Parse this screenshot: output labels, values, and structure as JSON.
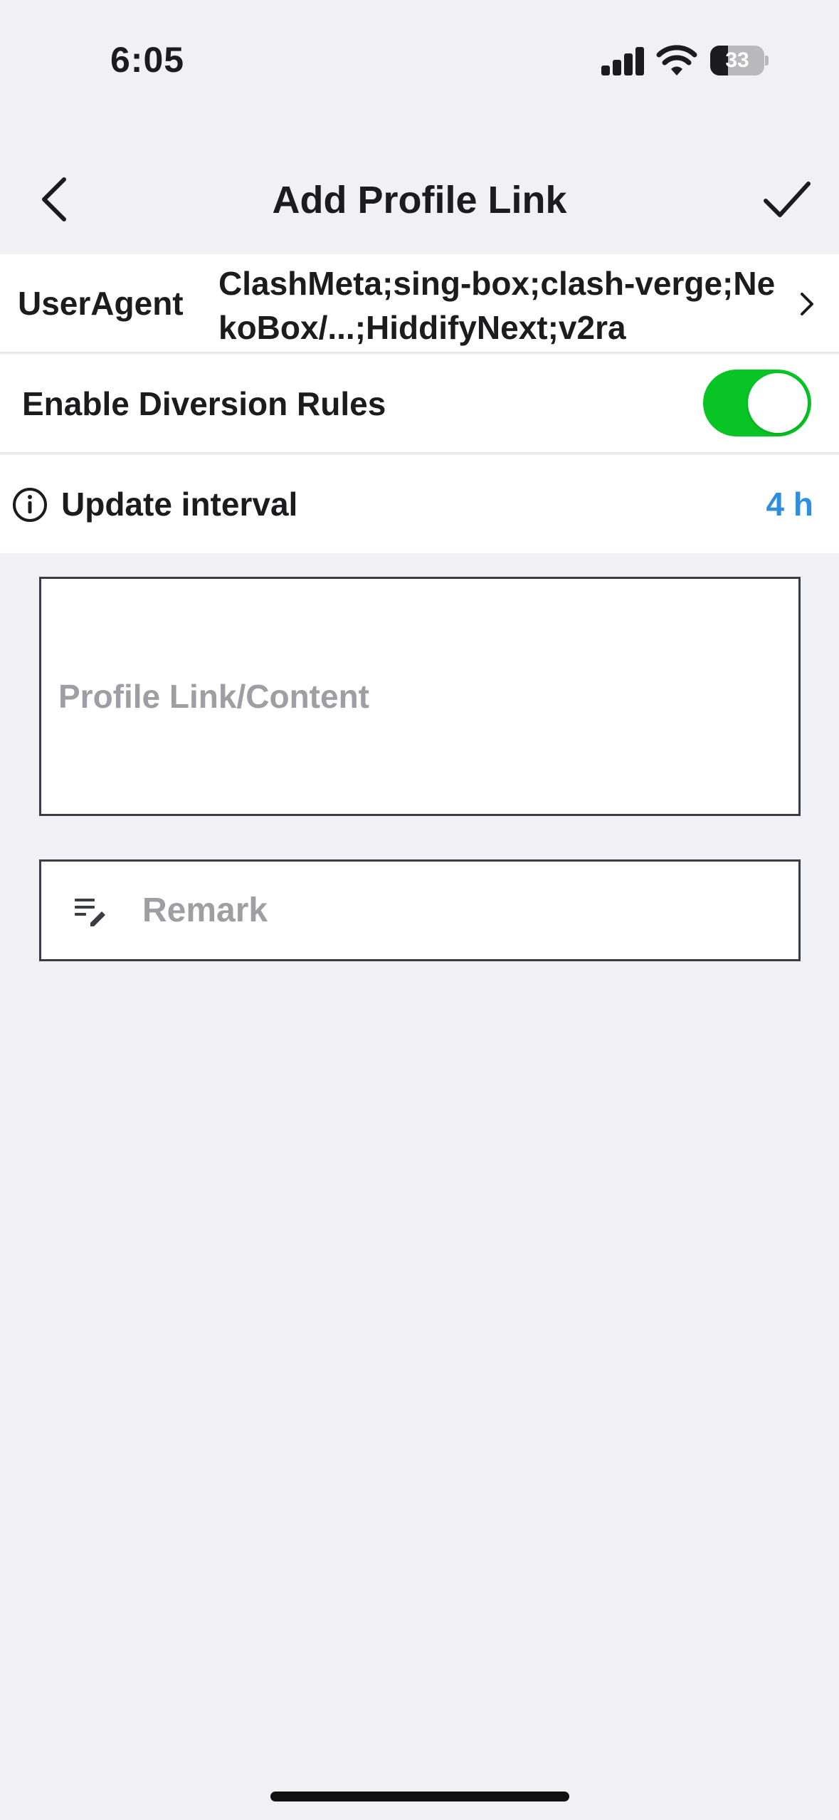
{
  "status_bar": {
    "time": "6:05",
    "battery_level": "33",
    "battery_fraction": 0.33
  },
  "nav": {
    "title": "Add Profile Link",
    "back_icon": "chevron-left-icon",
    "confirm_icon": "checkmark-icon"
  },
  "settings": {
    "user_agent": {
      "label": "UserAgent",
      "value": "ClashMeta;sing-box;clash-verge;NekoBox/...;HiddifyNext;v2ra"
    },
    "diversion": {
      "label": "Enable Diversion Rules",
      "enabled": true
    },
    "update_interval": {
      "label": "Update interval",
      "value": "4 h"
    }
  },
  "inputs": {
    "profile": {
      "placeholder": "Profile Link/Content",
      "value": ""
    },
    "remark": {
      "placeholder": "Remark",
      "value": "",
      "icon": "edit-note-icon"
    }
  },
  "colors": {
    "accent_green": "#08c424",
    "link_blue": "#2d8fdd",
    "background": "#f0f0f5"
  }
}
